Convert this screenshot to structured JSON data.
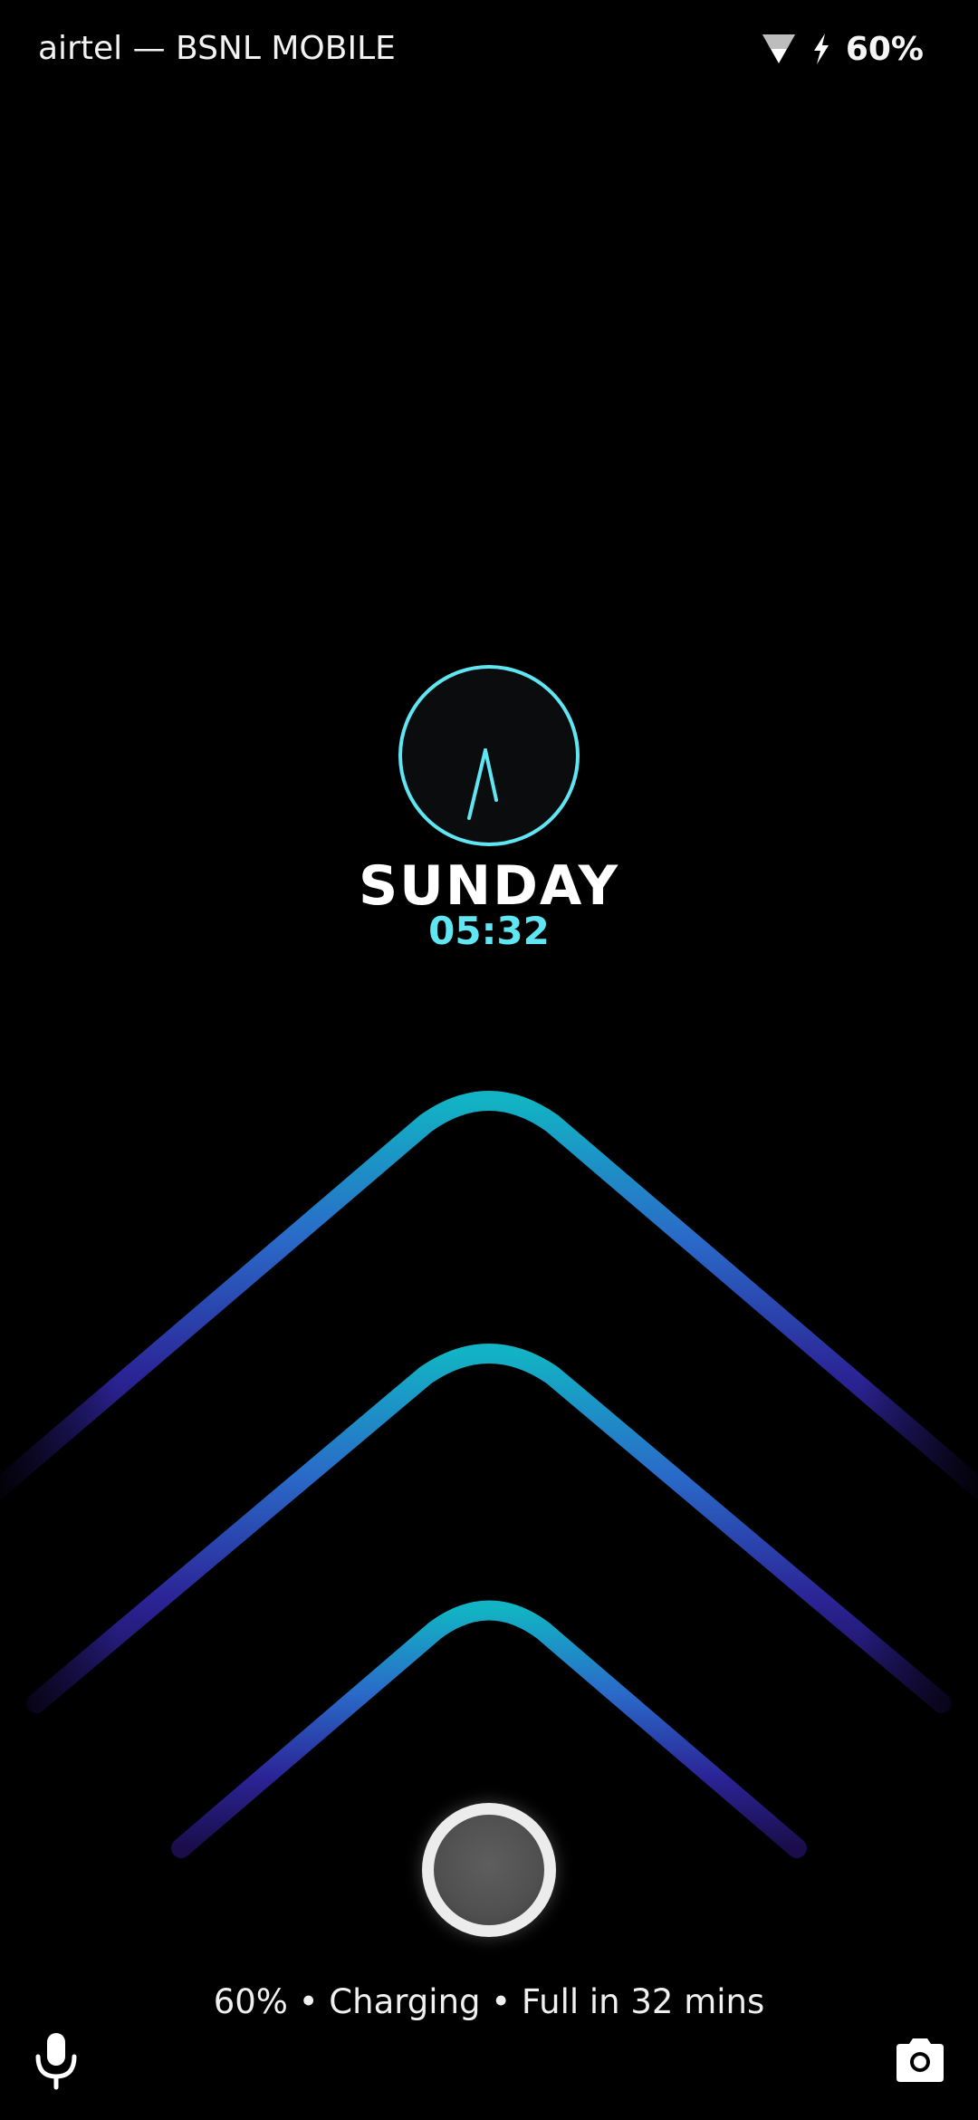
{
  "status_bar": {
    "carrier": "airtel — BSNL MOBILE",
    "battery_percent": "60%",
    "signal_icon": "signal-icon",
    "charging_icon": "bolt-icon"
  },
  "lock_screen": {
    "day": "SUNDAY",
    "time": "05:32",
    "clock_icon": "analog-clock-icon",
    "charging_status": "60% • Charging • Full in 32 mins"
  },
  "bottom_shortcuts": {
    "left_icon": "microphone-icon",
    "right_icon": "camera-icon"
  },
  "colors": {
    "background": "#000000",
    "accent_cyan": "#5fe6f2",
    "chevron_top": "#12b3c4",
    "chevron_mid": "#2a5cc4",
    "chevron_end": "#2a1670"
  }
}
